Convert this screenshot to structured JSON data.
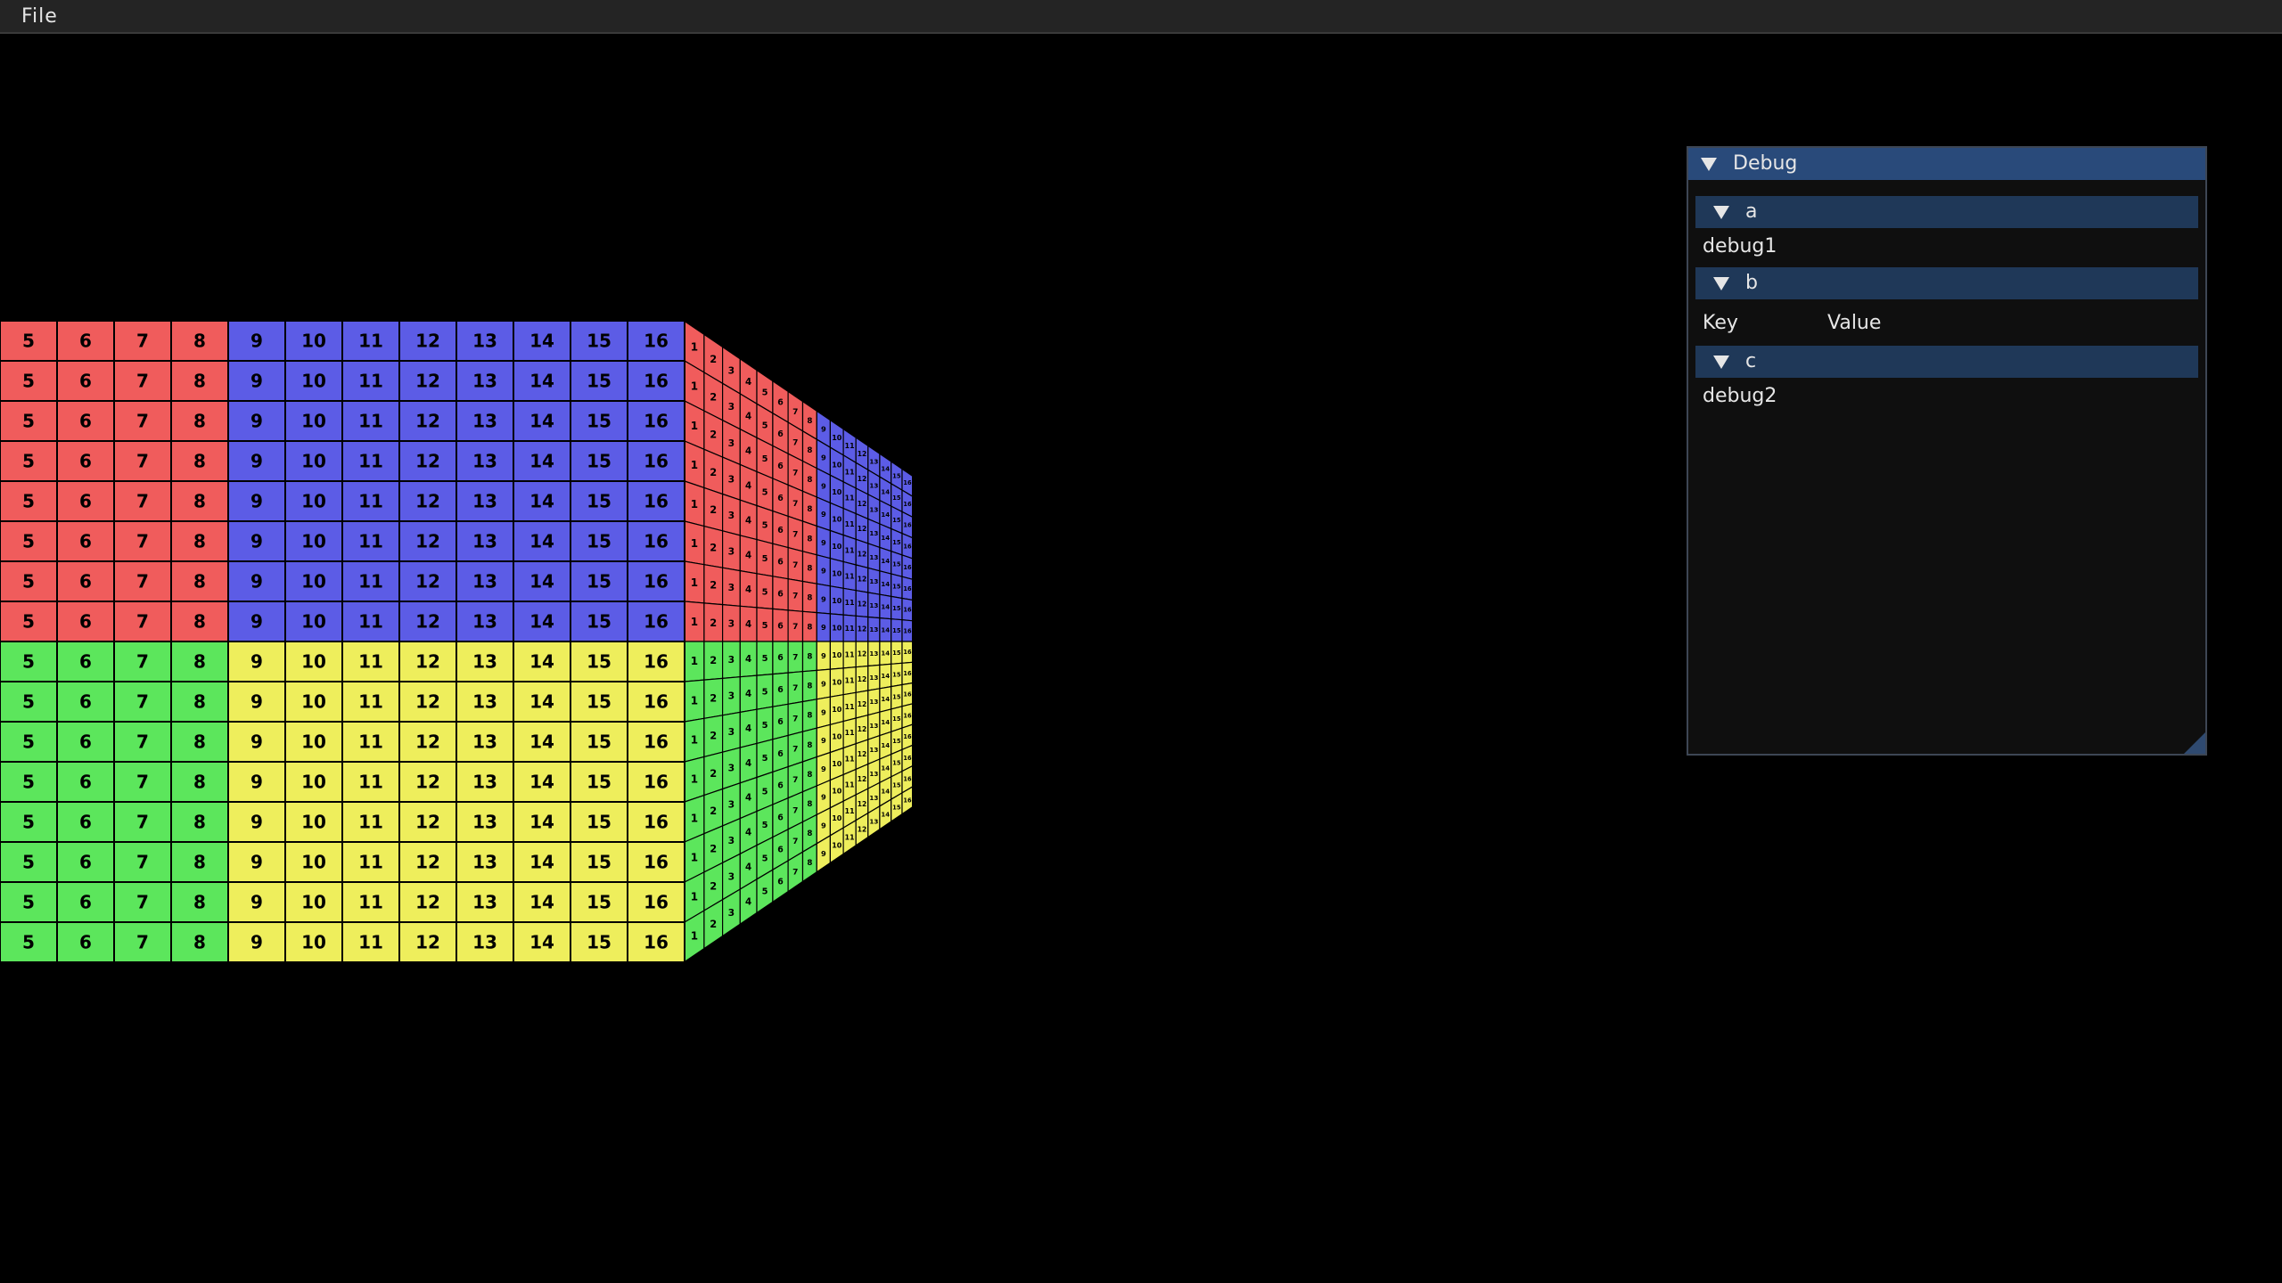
{
  "menubar": {
    "items": [
      {
        "label": "File"
      }
    ]
  },
  "scene": {
    "front_rows": 16,
    "front_columns": [
      "5",
      "6",
      "7",
      "8",
      "9",
      "10",
      "11",
      "12",
      "13",
      "14",
      "15",
      "16"
    ],
    "side_columns": [
      "1",
      "2",
      "3",
      "4",
      "5",
      "6",
      "7",
      "8",
      "9",
      "10",
      "11",
      "12",
      "13",
      "14",
      "15",
      "16"
    ],
    "colors": {
      "red": "#f05c5c",
      "blue": "#5c5ce6",
      "green": "#5ce65c",
      "yellow": "#eeee5c",
      "grid_line": "#000000",
      "label": "#000000"
    }
  },
  "debug": {
    "title": "Debug",
    "sections": [
      {
        "label": "a",
        "content": "debug1"
      },
      {
        "label": "b",
        "key_header": "Key",
        "value_header": "Value"
      },
      {
        "label": "c",
        "content": "debug2"
      }
    ]
  }
}
